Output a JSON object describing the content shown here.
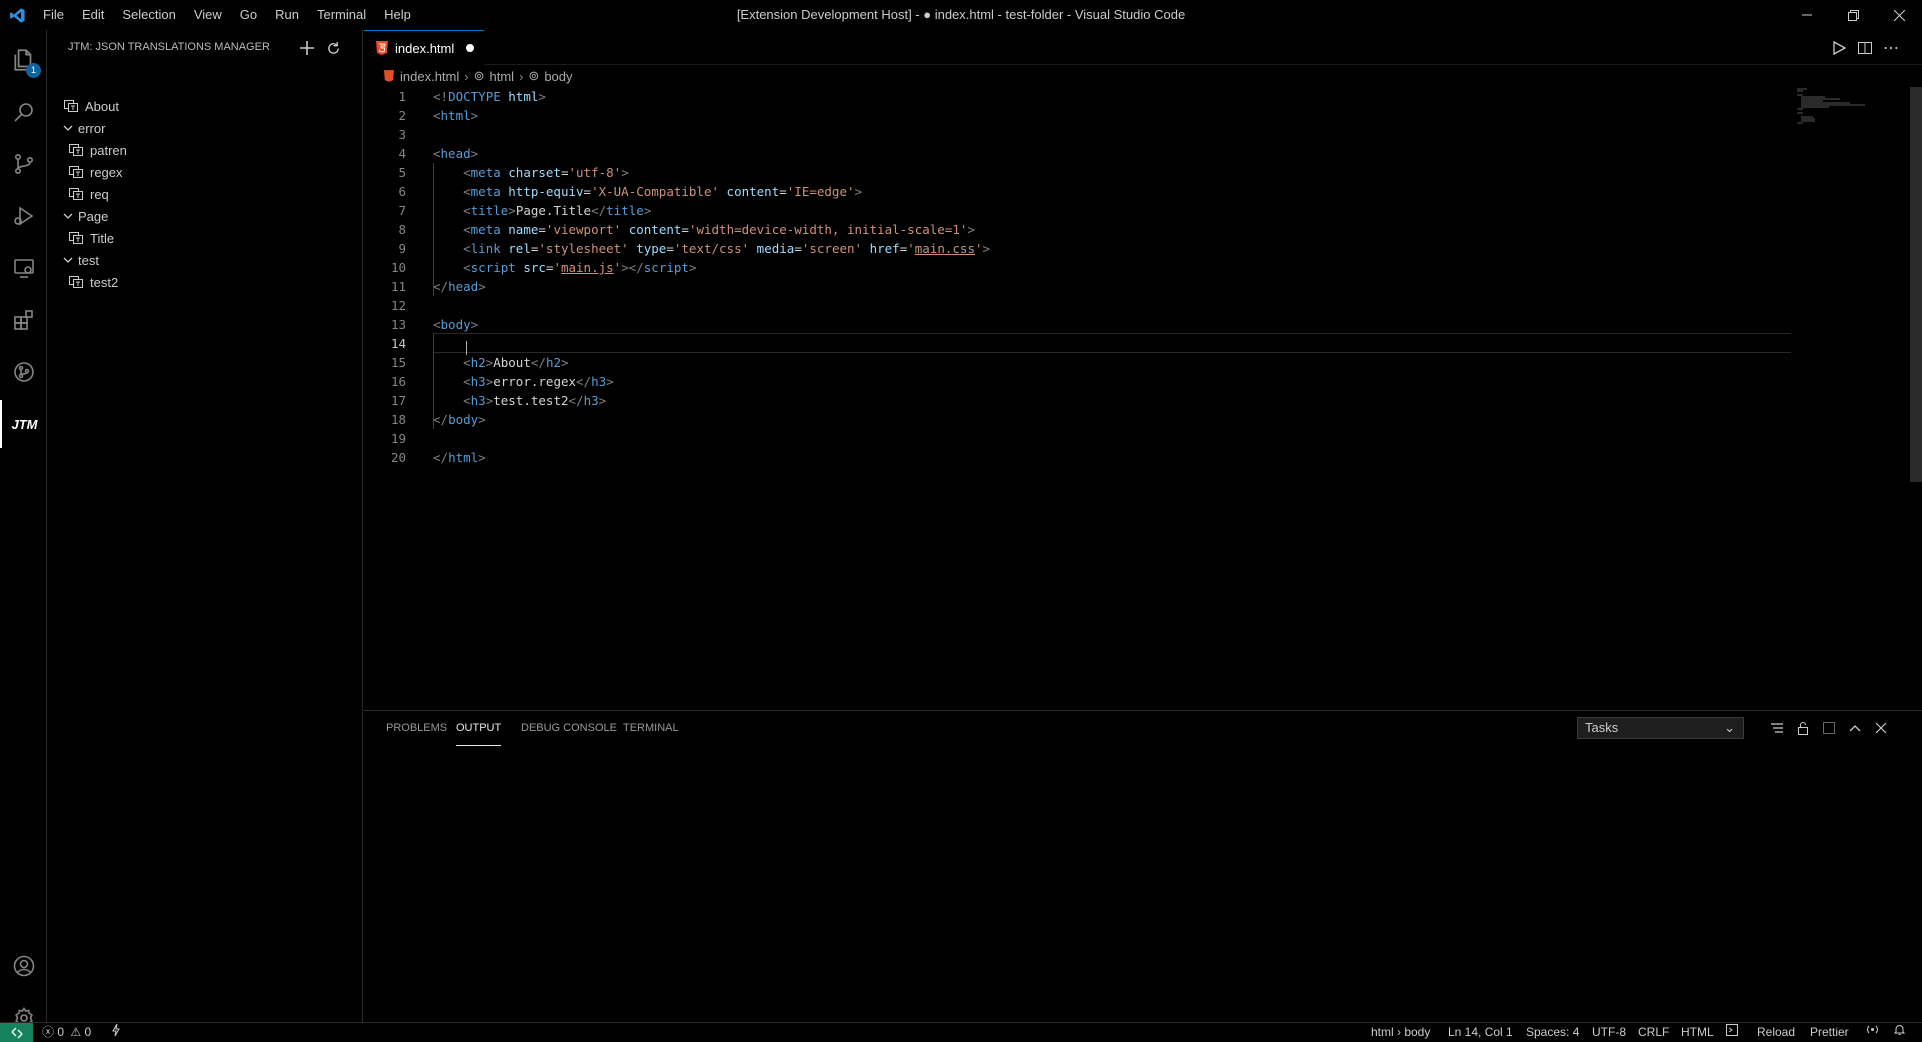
{
  "window": {
    "title": "[Extension Development Host] - ● index.html - test-folder - Visual Studio Code",
    "menu": [
      "File",
      "Edit",
      "Selection",
      "View",
      "Go",
      "Run",
      "Terminal",
      "Help"
    ]
  },
  "activity_bar": {
    "explorer_badge": "1",
    "items": [
      "explorer-icon",
      "search-icon",
      "source-control-icon",
      "run-debug-icon",
      "remote-explorer-icon",
      "extensions-icon",
      "git-graph-icon",
      "jtm-icon"
    ],
    "jtm_label": "JTM",
    "bottom": [
      "account-icon",
      "settings-gear-icon"
    ]
  },
  "sidebar": {
    "title": "JTM: JSON TRANSLATIONS MANAGER",
    "tree": [
      {
        "label": "About",
        "type": "leaf",
        "depth": 0
      },
      {
        "label": "error",
        "type": "group",
        "depth": 0
      },
      {
        "label": "patren",
        "type": "leaf",
        "depth": 1
      },
      {
        "label": "regex",
        "type": "leaf",
        "depth": 1
      },
      {
        "label": "req",
        "type": "leaf",
        "depth": 1
      },
      {
        "label": "Page",
        "type": "group",
        "depth": 0
      },
      {
        "label": "Title",
        "type": "leaf",
        "depth": 1
      },
      {
        "label": "test",
        "type": "group",
        "depth": 0
      },
      {
        "label": "test2",
        "type": "leaf",
        "depth": 1
      }
    ]
  },
  "editor": {
    "tab": {
      "label": "index.html",
      "dirty": true
    },
    "breadcrumb": [
      "index.html",
      "html",
      "body"
    ],
    "current_line": 14,
    "lines": [
      [
        [
          "p",
          "<!"
        ],
        [
          "t",
          "DOCTYPE"
        ],
        [
          "d",
          " "
        ],
        [
          "a",
          "html"
        ],
        [
          "p",
          ">"
        ]
      ],
      [
        [
          "p",
          "<"
        ],
        [
          "t",
          "html"
        ],
        [
          "p",
          ">"
        ]
      ],
      [],
      [
        [
          "p",
          "<"
        ],
        [
          "t",
          "head"
        ],
        [
          "p",
          ">"
        ]
      ],
      [
        [
          "d",
          "    "
        ],
        [
          "p",
          "<"
        ],
        [
          "t",
          "meta"
        ],
        [
          "d",
          " "
        ],
        [
          "a",
          "charset"
        ],
        [
          "d",
          "="
        ],
        [
          "s",
          "'utf-8'"
        ],
        [
          "p",
          ">"
        ]
      ],
      [
        [
          "d",
          "    "
        ],
        [
          "p",
          "<"
        ],
        [
          "t",
          "meta"
        ],
        [
          "d",
          " "
        ],
        [
          "a",
          "http-equiv"
        ],
        [
          "d",
          "="
        ],
        [
          "s",
          "'X-UA-Compatible'"
        ],
        [
          "d",
          " "
        ],
        [
          "a",
          "content"
        ],
        [
          "d",
          "="
        ],
        [
          "s",
          "'IE=edge'"
        ],
        [
          "p",
          ">"
        ]
      ],
      [
        [
          "d",
          "    "
        ],
        [
          "p",
          "<"
        ],
        [
          "t",
          "title"
        ],
        [
          "p",
          ">"
        ],
        [
          "d",
          "Page.Title"
        ],
        [
          "p",
          "</"
        ],
        [
          "t",
          "title"
        ],
        [
          "p",
          ">"
        ]
      ],
      [
        [
          "d",
          "    "
        ],
        [
          "p",
          "<"
        ],
        [
          "t",
          "meta"
        ],
        [
          "d",
          " "
        ],
        [
          "a",
          "name"
        ],
        [
          "d",
          "="
        ],
        [
          "s",
          "'viewport'"
        ],
        [
          "d",
          " "
        ],
        [
          "a",
          "content"
        ],
        [
          "d",
          "="
        ],
        [
          "s",
          "'width=device-width, initial-scale=1'"
        ],
        [
          "p",
          ">"
        ]
      ],
      [
        [
          "d",
          "    "
        ],
        [
          "p",
          "<"
        ],
        [
          "t",
          "link"
        ],
        [
          "d",
          " "
        ],
        [
          "a",
          "rel"
        ],
        [
          "d",
          "="
        ],
        [
          "s",
          "'stylesheet'"
        ],
        [
          "d",
          " "
        ],
        [
          "a",
          "type"
        ],
        [
          "d",
          "="
        ],
        [
          "s",
          "'text/css'"
        ],
        [
          "d",
          " "
        ],
        [
          "a",
          "media"
        ],
        [
          "d",
          "="
        ],
        [
          "s",
          "'screen'"
        ],
        [
          "d",
          " "
        ],
        [
          "a",
          "href"
        ],
        [
          "d",
          "="
        ],
        [
          "s",
          "'"
        ],
        [
          "su",
          "main.css"
        ],
        [
          "s",
          "'"
        ],
        [
          "p",
          ">"
        ]
      ],
      [
        [
          "d",
          "    "
        ],
        [
          "p",
          "<"
        ],
        [
          "t",
          "script"
        ],
        [
          "d",
          " "
        ],
        [
          "a",
          "src"
        ],
        [
          "d",
          "="
        ],
        [
          "s",
          "'"
        ],
        [
          "su",
          "main.js"
        ],
        [
          "s",
          "'"
        ],
        [
          "p",
          "></"
        ],
        [
          "t",
          "script"
        ],
        [
          "p",
          ">"
        ]
      ],
      [
        [
          "p",
          "</"
        ],
        [
          "t",
          "head"
        ],
        [
          "p",
          ">"
        ]
      ],
      [],
      [
        [
          "p",
          "<"
        ],
        [
          "t",
          "body"
        ],
        [
          "p",
          ">"
        ]
      ],
      [],
      [
        [
          "d",
          "    "
        ],
        [
          "p",
          "<"
        ],
        [
          "t",
          "h2"
        ],
        [
          "p",
          ">"
        ],
        [
          "d",
          "About"
        ],
        [
          "p",
          "</"
        ],
        [
          "t",
          "h2"
        ],
        [
          "p",
          ">"
        ]
      ],
      [
        [
          "d",
          "    "
        ],
        [
          "p",
          "<"
        ],
        [
          "t",
          "h3"
        ],
        [
          "p",
          ">"
        ],
        [
          "d",
          "error.regex"
        ],
        [
          "p",
          "</"
        ],
        [
          "t",
          "h3"
        ],
        [
          "p",
          ">"
        ]
      ],
      [
        [
          "d",
          "    "
        ],
        [
          "p",
          "<"
        ],
        [
          "t",
          "h3"
        ],
        [
          "p",
          ">"
        ],
        [
          "d",
          "test.test2"
        ],
        [
          "p",
          "</"
        ],
        [
          "t",
          "h3"
        ],
        [
          "p",
          ">"
        ]
      ],
      [
        [
          "p",
          "</"
        ],
        [
          "t",
          "body"
        ],
        [
          "p",
          ">"
        ]
      ],
      [],
      [
        [
          "p",
          "</"
        ],
        [
          "t",
          "html"
        ],
        [
          "p",
          ">"
        ]
      ]
    ]
  },
  "panel": {
    "tabs": [
      "PROBLEMS",
      "OUTPUT",
      "DEBUG CONSOLE",
      "TERMINAL"
    ],
    "active_tab": "OUTPUT",
    "channel": "Tasks"
  },
  "status_bar": {
    "errors": "0",
    "warnings": "0",
    "items": [
      "html › body",
      "Ln 14, Col 1",
      "Spaces: 4",
      "UTF-8",
      "CRLF",
      "HTML",
      "Reload",
      "Prettier"
    ]
  },
  "colors": {
    "accent": "#0078d4",
    "tag": "#569cd6",
    "attr": "#9cdcfe",
    "string": "#ce9178",
    "html_icon": "#e44d26"
  }
}
